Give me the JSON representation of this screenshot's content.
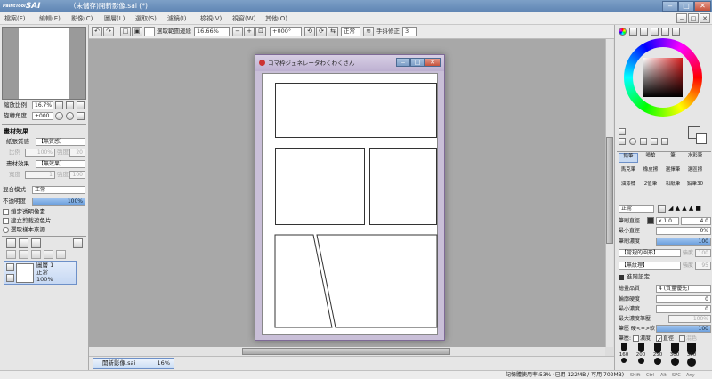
{
  "app": {
    "logo_small": "PaintTool",
    "logo_big": "SAI",
    "window_title": "（未儲存)開新影像.sai (*)",
    "window_buttons": [
      "‒",
      "□",
      "✕"
    ],
    "mdi_buttons": [
      "‒",
      "□",
      "✕"
    ]
  },
  "menu": [
    "檔案(F)",
    "編輯(E)",
    "影像(C)",
    "圖層(L)",
    "選取(S)",
    "濾鏡(I)",
    "檢視(V)",
    "視窗(W)",
    "其他(O)"
  ],
  "toolbar": {
    "select_edges_label": "選取範圍邊緣",
    "zoom": "16.66%",
    "rotation": "+000°",
    "blend": "正常",
    "stabilizer_label": "手抖修正",
    "stabilizer_value": "3"
  },
  "navigator": {
    "zoom_label": "縮放比例",
    "zoom_value": "16.7%",
    "rotate_label": "旋轉角度",
    "rotate_value": "+000"
  },
  "material": {
    "header": "畫材效果",
    "paper_label": "紙張質感",
    "paper_value": "【無質感】",
    "scale_label": "比例",
    "scale_value": "100%",
    "strength_label": "強度",
    "strength_value": "20",
    "effect_label": "畫材效果",
    "effect_value": "【無效果】",
    "width_label": "寬度",
    "width_value": "1",
    "strength2_value": "100"
  },
  "layer_props": {
    "blend_label": "混合模式",
    "blend_value": "正常",
    "opacity_label": "不透明度",
    "opacity_value": "100%",
    "protect_alpha": "鎖定透明像素",
    "clip_group": "建立剪裁遮色片",
    "selection_source": "選取樣本來源"
  },
  "layers": [
    {
      "name": "圖層 1",
      "mode": "正常",
      "opacity": "100%"
    }
  ],
  "document": {
    "subwindow_title": "コマ枠ジェネレータわくわくさん",
    "tab_name": "開新影像.sai",
    "tab_zoom": "16%"
  },
  "status": {
    "memory": "記憶體使用率:53% (已用 122MB / 可用 702MB)",
    "keys": [
      "Shift",
      "Ctrl",
      "Alt",
      "SPC",
      "Any"
    ]
  },
  "tools": [
    {
      "label": "鉛筆",
      "selected": true
    },
    {
      "label": "噴槍",
      "selected": false
    },
    {
      "label": "筆",
      "selected": false
    },
    {
      "label": "水彩筆",
      "selected": false
    },
    {
      "label": "馬克筆",
      "selected": false
    },
    {
      "label": "橡皮擦",
      "selected": false
    },
    {
      "label": "選擇筆",
      "selected": false
    },
    {
      "label": "選區擦",
      "selected": false
    },
    {
      "label": "油漆桶",
      "selected": false
    },
    {
      "label": "2值筆",
      "selected": false
    },
    {
      "label": "和紙筆",
      "selected": false
    },
    {
      "label": "鉛筆30",
      "selected": false
    }
  ],
  "brush": {
    "mode": "正常",
    "size_label": "筆刷直徑",
    "size_mult": "x 1.0",
    "size_value": "4.0",
    "min_size_label": "最小直徑",
    "min_size_value": "0%",
    "density_label": "筆刷濃度",
    "density_value": "100",
    "shape_value": "【常規的圓形】",
    "shape_strength_label": "強度",
    "shape_strength_value": "100",
    "texture_value": "【無紋理】",
    "texture_strength_label": "強度",
    "texture_strength_value": "95",
    "advanced_label": "進階設定",
    "quality_label": "繪畫品質",
    "quality_value": "4 (質量優先)",
    "edge_label": "輪廓硬度",
    "edge_value": "0",
    "min_density_label": "最小濃度",
    "min_density_value": "0",
    "max_density_pressure_label": "最大濃度筆壓",
    "max_density_pressure_value": "100%",
    "pressure_label": "筆壓 硬<=>軟",
    "pressure_value": "100",
    "pressure_opts_label": "筆壓:",
    "pressure_opt_density": "濃度",
    "pressure_opt_size": "直徑",
    "pressure_opt_blend": "混色"
  },
  "brush_sizes": [
    "160",
    "200",
    "250",
    "300",
    "350"
  ],
  "colors": {
    "primary": "#111111",
    "secondary": "#ffffff",
    "wheel_selected": "#d81e1e"
  }
}
